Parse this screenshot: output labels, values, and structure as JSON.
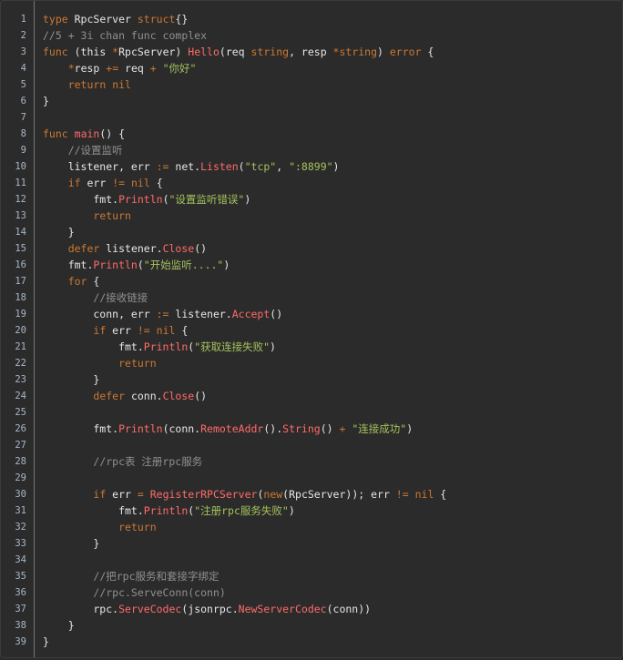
{
  "editor": {
    "lines": [
      [
        [
          "kw",
          "type"
        ],
        [
          "pl",
          " RpcServer "
        ],
        [
          "kw",
          "struct"
        ],
        [
          "pl",
          "{}"
        ]
      ],
      [
        [
          "cm",
          "//5 + 3i chan func complex"
        ]
      ],
      [
        [
          "kw",
          "func"
        ],
        [
          "pl",
          " (this "
        ],
        [
          "kw",
          "*"
        ],
        [
          "pl",
          "RpcServer) "
        ],
        [
          "fn",
          "Hello"
        ],
        [
          "pl",
          "(req "
        ],
        [
          "kw",
          "string"
        ],
        [
          "pl",
          ", resp "
        ],
        [
          "kw",
          "*string"
        ],
        [
          "pl",
          ") "
        ],
        [
          "kw",
          "error"
        ],
        [
          "pl",
          " {"
        ]
      ],
      [
        [
          "pl",
          "    "
        ],
        [
          "kw",
          "*"
        ],
        [
          "pl",
          "resp "
        ],
        [
          "kw",
          "+="
        ],
        [
          "pl",
          " req "
        ],
        [
          "kw",
          "+"
        ],
        [
          "pl",
          " "
        ],
        [
          "str",
          "\"你好\""
        ]
      ],
      [
        [
          "pl",
          "    "
        ],
        [
          "kw",
          "return"
        ],
        [
          "pl",
          " "
        ],
        [
          "kw",
          "nil"
        ]
      ],
      [
        [
          "pl",
          "}"
        ]
      ],
      [],
      [
        [
          "kw",
          "func"
        ],
        [
          "pl",
          " "
        ],
        [
          "fn",
          "main"
        ],
        [
          "pl",
          "() {"
        ]
      ],
      [
        [
          "pl",
          "    "
        ],
        [
          "cm",
          "//设置监听"
        ]
      ],
      [
        [
          "pl",
          "    listener, err "
        ],
        [
          "kw",
          ":="
        ],
        [
          "pl",
          " net."
        ],
        [
          "fn",
          "Listen"
        ],
        [
          "pl",
          "("
        ],
        [
          "str",
          "\"tcp\""
        ],
        [
          "pl",
          ", "
        ],
        [
          "str",
          "\":8899\""
        ],
        [
          "pl",
          ")"
        ]
      ],
      [
        [
          "pl",
          "    "
        ],
        [
          "kw",
          "if"
        ],
        [
          "pl",
          " err "
        ],
        [
          "kw",
          "!="
        ],
        [
          "pl",
          " "
        ],
        [
          "kw",
          "nil"
        ],
        [
          "pl",
          " {"
        ]
      ],
      [
        [
          "pl",
          "        fmt."
        ],
        [
          "fn",
          "Println"
        ],
        [
          "pl",
          "("
        ],
        [
          "str",
          "\"设置监听错误\""
        ],
        [
          "pl",
          ")"
        ]
      ],
      [
        [
          "pl",
          "        "
        ],
        [
          "kw",
          "return"
        ]
      ],
      [
        [
          "pl",
          "    }"
        ]
      ],
      [
        [
          "pl",
          "    "
        ],
        [
          "kw",
          "defer"
        ],
        [
          "pl",
          " listener."
        ],
        [
          "fn",
          "Close"
        ],
        [
          "pl",
          "()"
        ]
      ],
      [
        [
          "pl",
          "    fmt."
        ],
        [
          "fn",
          "Println"
        ],
        [
          "pl",
          "("
        ],
        [
          "str",
          "\"开始监听....\""
        ],
        [
          "pl",
          ")"
        ]
      ],
      [
        [
          "pl",
          "    "
        ],
        [
          "kw",
          "for"
        ],
        [
          "pl",
          " {"
        ]
      ],
      [
        [
          "pl",
          "        "
        ],
        [
          "cm",
          "//接收链接"
        ]
      ],
      [
        [
          "pl",
          "        conn, err "
        ],
        [
          "kw",
          ":="
        ],
        [
          "pl",
          " listener."
        ],
        [
          "fn",
          "Accept"
        ],
        [
          "pl",
          "()"
        ]
      ],
      [
        [
          "pl",
          "        "
        ],
        [
          "kw",
          "if"
        ],
        [
          "pl",
          " err "
        ],
        [
          "kw",
          "!="
        ],
        [
          "pl",
          " "
        ],
        [
          "kw",
          "nil"
        ],
        [
          "pl",
          " {"
        ]
      ],
      [
        [
          "pl",
          "            fmt."
        ],
        [
          "fn",
          "Println"
        ],
        [
          "pl",
          "("
        ],
        [
          "str",
          "\"获取连接失败\""
        ],
        [
          "pl",
          ")"
        ]
      ],
      [
        [
          "pl",
          "            "
        ],
        [
          "kw",
          "return"
        ]
      ],
      [
        [
          "pl",
          "        }"
        ]
      ],
      [
        [
          "pl",
          "        "
        ],
        [
          "kw",
          "defer"
        ],
        [
          "pl",
          " conn."
        ],
        [
          "fn",
          "Close"
        ],
        [
          "pl",
          "()"
        ]
      ],
      [],
      [
        [
          "pl",
          "        fmt."
        ],
        [
          "fn",
          "Println"
        ],
        [
          "pl",
          "(conn."
        ],
        [
          "fn",
          "RemoteAddr"
        ],
        [
          "pl",
          "()."
        ],
        [
          "fn",
          "String"
        ],
        [
          "pl",
          "() "
        ],
        [
          "kw",
          "+"
        ],
        [
          "pl",
          " "
        ],
        [
          "str",
          "\"连接成功\""
        ],
        [
          "pl",
          ")"
        ]
      ],
      [],
      [
        [
          "pl",
          "        "
        ],
        [
          "cm",
          "//rpc表 注册rpc服务"
        ]
      ],
      [],
      [
        [
          "pl",
          "        "
        ],
        [
          "kw",
          "if"
        ],
        [
          "pl",
          " err "
        ],
        [
          "kw",
          "="
        ],
        [
          "pl",
          " "
        ],
        [
          "fn",
          "RegisterRPCServer"
        ],
        [
          "pl",
          "("
        ],
        [
          "kw",
          "new"
        ],
        [
          "pl",
          "(RpcServer)); err "
        ],
        [
          "kw",
          "!="
        ],
        [
          "pl",
          " "
        ],
        [
          "kw",
          "nil"
        ],
        [
          "pl",
          " {"
        ]
      ],
      [
        [
          "pl",
          "            fmt."
        ],
        [
          "fn",
          "Println"
        ],
        [
          "pl",
          "("
        ],
        [
          "str",
          "\"注册rpc服务失败\""
        ],
        [
          "pl",
          ")"
        ]
      ],
      [
        [
          "pl",
          "            "
        ],
        [
          "kw",
          "return"
        ]
      ],
      [
        [
          "pl",
          "        }"
        ]
      ],
      [],
      [
        [
          "pl",
          "        "
        ],
        [
          "cm",
          "//把rpc服务和套接字绑定"
        ]
      ],
      [
        [
          "pl",
          "        "
        ],
        [
          "cm",
          "//rpc.ServeConn(conn)"
        ]
      ],
      [
        [
          "pl",
          "        rpc."
        ],
        [
          "fn",
          "ServeCodec"
        ],
        [
          "pl",
          "(jsonrpc."
        ],
        [
          "fn",
          "NewServerCodec"
        ],
        [
          "pl",
          "(conn))"
        ]
      ],
      [
        [
          "pl",
          "    }"
        ]
      ],
      [
        [
          "pl",
          "}"
        ]
      ]
    ]
  }
}
